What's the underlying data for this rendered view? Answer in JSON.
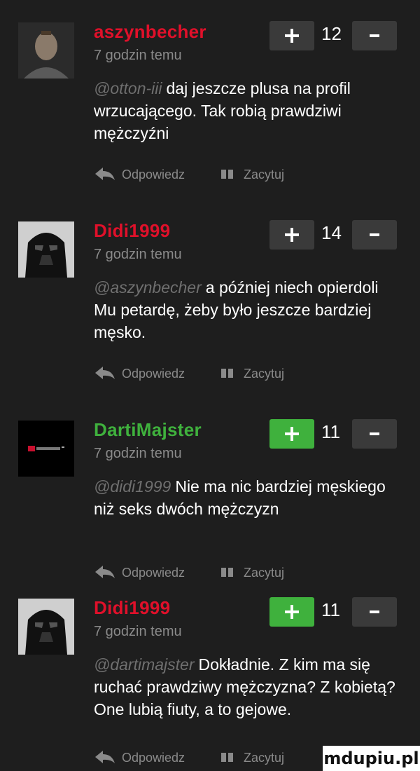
{
  "comments": [
    {
      "username": "aszynbecher",
      "time": "7 godzin temu",
      "score": "12",
      "mention": "@otton-iii",
      "text": "daj jeszcze plusa na profil wrzucającego. Tak robią prawdziwi mężczyźni",
      "plus_active": false,
      "avatar": "man-face-avatar",
      "reply_label": "Odpowiedz",
      "quote_label": "Zacytuj"
    },
    {
      "username": "Didi1999",
      "time": "7 godzin temu",
      "score": "14",
      "mention": "@aszynbecher",
      "text": "a później niech opierdoli Mu petardę, żeby było jeszcze bardziej męsko.",
      "plus_active": false,
      "avatar": "darth-vader-avatar",
      "reply_label": "Odpowiedz",
      "quote_label": "Zacytuj"
    },
    {
      "username": "DartiMajster",
      "time": "7 godzin temu",
      "score": "11",
      "mention": "@didi1999",
      "text": "Nie ma nic bardziej męskiego niż seks dwóch mężczyzn",
      "plus_active": true,
      "avatar": "dark-logo-avatar",
      "reply_label": "Odpowiedz",
      "quote_label": "Zacytuj"
    },
    {
      "username": "Didi1999",
      "time": "7 godzin temu",
      "score": "11",
      "mention": "@dartimajster",
      "text": "Dokładnie. Z kim ma się ruchać prawdziwy mężczyzna? Z kobietą? One lubią fiuty, a to gejowe.",
      "plus_active": true,
      "avatar": "darth-vader-avatar",
      "reply_label": "Odpowiedz",
      "quote_label": "Zacytuj"
    }
  ],
  "watermark": "mdupiu.pl",
  "colors": {
    "background": "#1e1e1e",
    "username": "#e0102a",
    "vote_bg": "#3a3a3a",
    "vote_active": "#3fb13d",
    "muted": "#8a8a8a"
  }
}
